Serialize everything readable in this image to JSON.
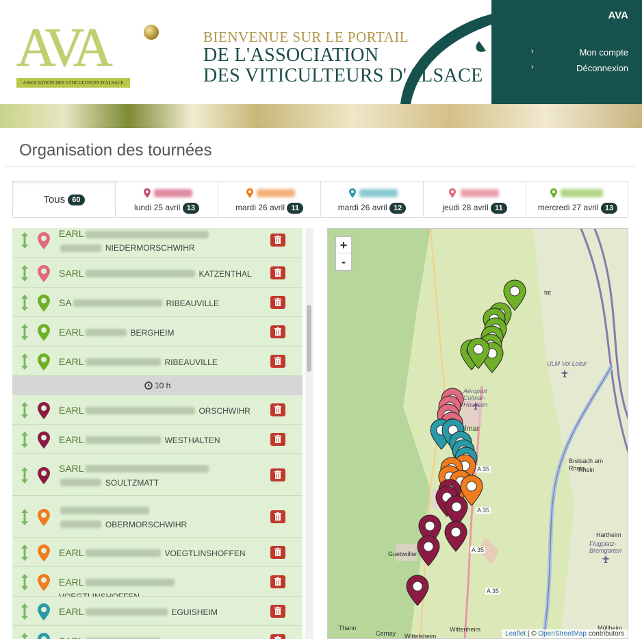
{
  "header": {
    "logo_letters": "AVA",
    "logo_tagline": "ASSOCIATION DES VITICULTEURS D'ALSACE",
    "welcome_line1": "BIENVENUE SUR LE PORTAIL",
    "welcome_line2": "DE L'ASSOCIATION",
    "welcome_line3": "DES VITICULTEURS D'ALSACE",
    "user_name": "AVA",
    "links": [
      {
        "label": "Mon compte"
      },
      {
        "label": "Déconnexion"
      }
    ]
  },
  "page_title": "Organisation des tournées",
  "tabs": [
    {
      "label": "Tous",
      "count": "60"
    },
    {
      "date": "lundi 25 avril",
      "count": "13",
      "color": "#c0506e"
    },
    {
      "date": "mardi 26 avril",
      "count": "11",
      "color": "#f07c1e"
    },
    {
      "date": "mardi 26 avril",
      "count": "12",
      "color": "#2a9aa8"
    },
    {
      "date": "jeudi 28 avril",
      "count": "11",
      "color": "#e06a80"
    },
    {
      "date": "mercredi 27 avril",
      "count": "13",
      "color": "#6fb028"
    }
  ],
  "rows": [
    {
      "type": "EARL",
      "city": "NIEDERMORSCHWIHR",
      "color": "#e06a80",
      "two": true
    },
    {
      "type": "SARL",
      "city": "KATZENTHAL",
      "color": "#e06a80"
    },
    {
      "type": "SA",
      "city": "RIBEAUVILLE",
      "color": "#6fb028"
    },
    {
      "type": "EARL",
      "city": "BERGHEIM",
      "color": "#6fb028"
    },
    {
      "type": "EARL",
      "city": "RIBEAUVILLE",
      "color": "#6fb028"
    },
    {
      "type": "EARL",
      "city": "ORSCHWIHR",
      "color": "#8c1b43"
    },
    {
      "type": "EARL",
      "city": "WESTHALTEN",
      "color": "#8c1b43"
    },
    {
      "type": "SARL",
      "city": "SOULTZMATT",
      "color": "#8c1b43",
      "two": true
    },
    {
      "type": "",
      "city": "OBERMORSCHWIHR",
      "color": "#f07c1e",
      "two": true
    },
    {
      "type": "EARL",
      "city": "VOEGTLINSHOFFEN",
      "color": "#f07c1e"
    },
    {
      "type": "EARL",
      "city": "VOEGTLINSHOFFEN",
      "color": "#f07c1e"
    },
    {
      "type": "EARL",
      "city": "EGUISHEIM",
      "color": "#2a9aa8"
    },
    {
      "type": "SARL",
      "city": "",
      "color": "#2a9aa8"
    }
  ],
  "separator_label": "10 h",
  "map": {
    "zoom_in": "+",
    "zoom_out": "-",
    "labels": [
      "Colmar",
      "Breisach am Rhein",
      "Guebwiller",
      "Hartheim",
      "Flugplatz-Bremgarten",
      "ULM Vol Loisir",
      "Aéroport Colmar-Houssen",
      "Thann",
      "Cernay",
      "Wittenheim",
      "Wittelsheim",
      "Müllheim",
      "A 35",
      "A 35",
      "A 35",
      "A 35",
      "Rhein",
      "tat"
    ],
    "attribution_leaflet": "Leaflet",
    "attribution_sep": " | © ",
    "attribution_osm": "OpenStreetMap",
    "attribution_tail": " contributors"
  }
}
